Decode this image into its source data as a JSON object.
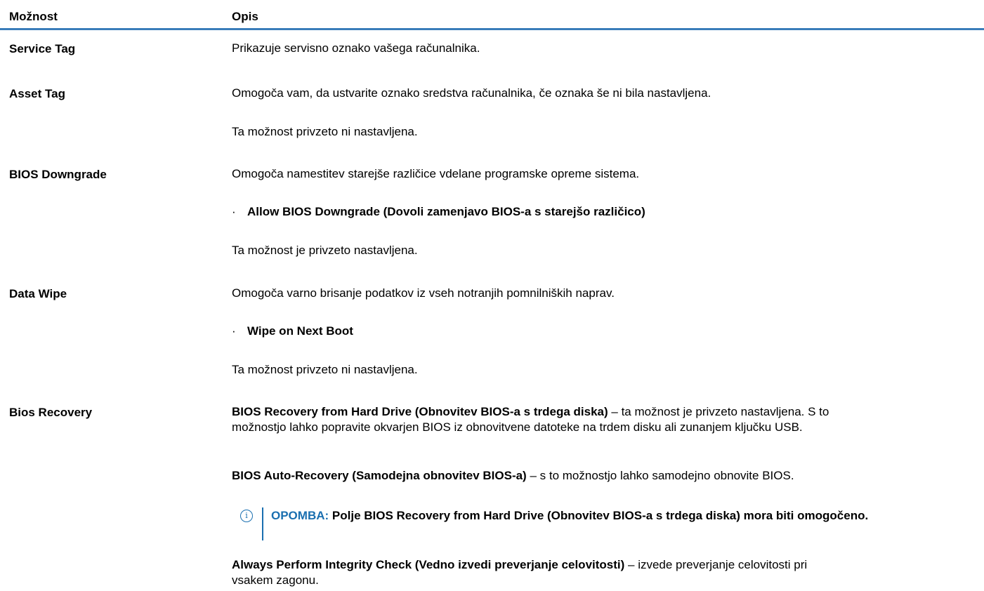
{
  "header": {
    "col_option": "Možnost",
    "col_description": "Opis"
  },
  "rows": [
    {
      "option": "Service Tag",
      "description": "Prikazuje servisno oznako vašega računalnika."
    },
    {
      "option": "Asset Tag",
      "description": "Omogoča vam, da ustvarite oznako sredstva računalnika, če oznaka še ni bila nastavljena.",
      "default": "Ta možnost privzeto ni nastavljena."
    },
    {
      "option": "BIOS Downgrade",
      "description": "Omogoča namestitev starejše različice vdelane programske opreme sistema.",
      "bullet": "Allow BIOS Downgrade (Dovoli zamenjavo BIOS-a s starejšo različico)",
      "default": "Ta možnost je privzeto nastavljena."
    },
    {
      "option": "Data Wipe",
      "description": "Omogoča varno brisanje podatkov iz vseh notranjih pomnilniških naprav.",
      "bullet": "Wipe on Next Boot",
      "default": "Ta možnost privzeto ni nastavljena."
    },
    {
      "option": "Bios Recovery",
      "para1_bold": "BIOS Recovery from Hard Drive (Obnovitev BIOS-a s trdega diska)",
      "para1_rest": " – ta možnost je privzeto nastavljena. S to možnostjo lahko popravite okvarjen BIOS iz obnovitvene datoteke na trdem disku ali zunanjem ključku USB.",
      "para2_bold": "BIOS Auto-Recovery (Samodejna obnovitev BIOS-a)",
      "para2_rest": " – s to možnostjo lahko samodejno obnovite BIOS.",
      "note_label": "OPOMBA:",
      "note_text": " Polje BIOS Recovery from Hard Drive (Obnovitev BIOS-a s trdega diska) mora biti omogočeno.",
      "para3_bold": "Always Perform Integrity Check (Vedno izvedi preverjanje celovitosti)",
      "para3_rest": " – izvede preverjanje celovitosti pri vsakem zagonu."
    }
  ],
  "icons": {
    "note": "info-icon",
    "bullet": "bullet-dot"
  },
  "colors": {
    "accent": "#1a6fb0",
    "header_rule": "#3a7dba"
  }
}
